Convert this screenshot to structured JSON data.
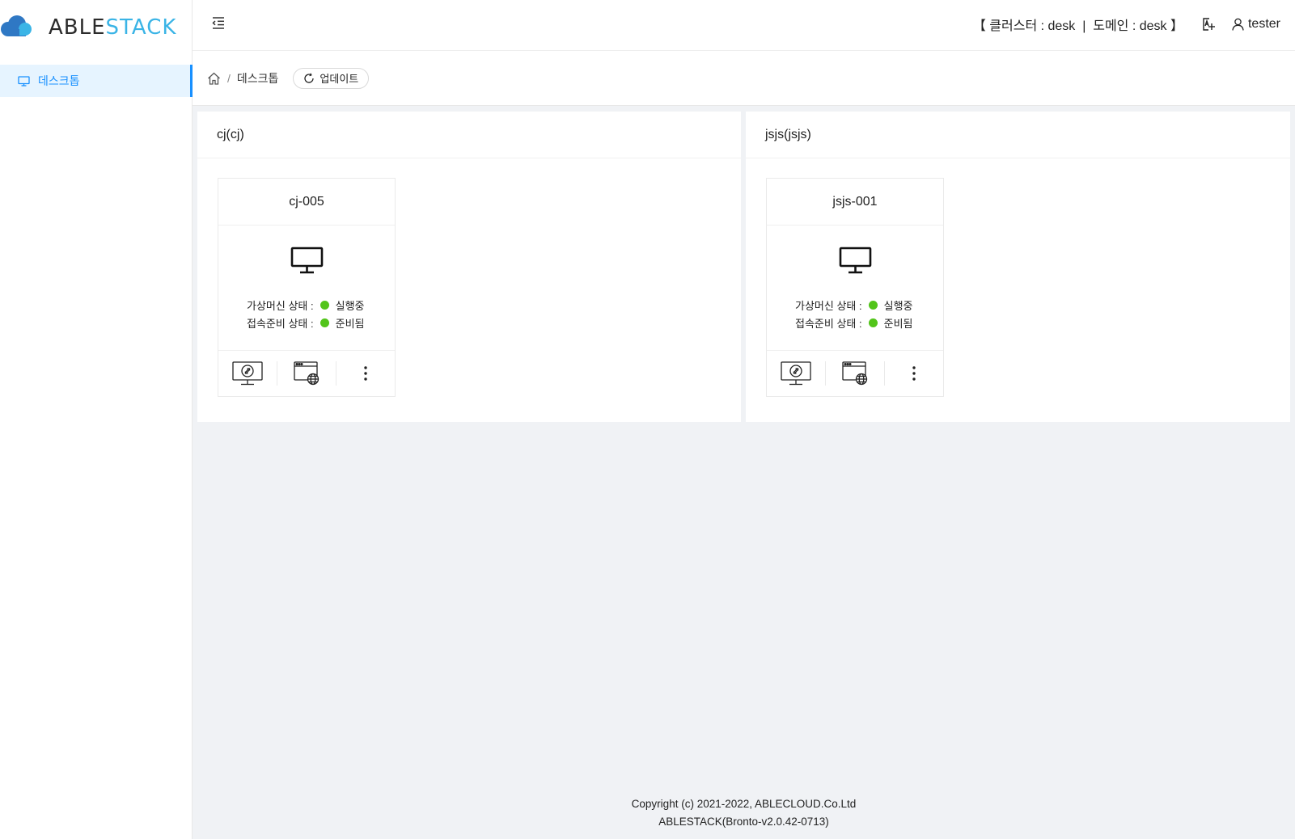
{
  "app": {
    "logo_part1": "ABLE",
    "logo_part2": "STACK",
    "brand_color": "#3ab4e6",
    "accent_color": "#1890ff"
  },
  "sidebar": {
    "items": [
      {
        "label": "데스크톱",
        "icon": "desktop-icon",
        "active": true
      }
    ]
  },
  "header": {
    "cluster_info": "【 클러스터 : desk  |  도메인 : desk 】",
    "user_name": "tester"
  },
  "breadcrumb": {
    "home_icon": "home-icon",
    "separator": "/",
    "current": "데스크톱",
    "update_label": "업데이트"
  },
  "groups": [
    {
      "title": "cj(cj)",
      "vm": {
        "name": "cj-005",
        "vm_state_label": "가상머신 상태 :",
        "vm_state": "실행중",
        "conn_state_label": "접속준비 상태 :",
        "conn_state": "준비됨",
        "status_color": "#52c41a"
      }
    },
    {
      "title": "jsjs(jsjs)",
      "vm": {
        "name": "jsjs-001",
        "vm_state_label": "가상머신 상태 :",
        "vm_state": "실행중",
        "conn_state_label": "접속준비 상태 :",
        "conn_state": "준비됨",
        "status_color": "#52c41a"
      }
    }
  ],
  "footer": {
    "copyright": "Copyright (c) 2021-2022, ABLECLOUD.Co.Ltd",
    "version": "ABLESTACK(Bronto-v2.0.42-0713)"
  }
}
